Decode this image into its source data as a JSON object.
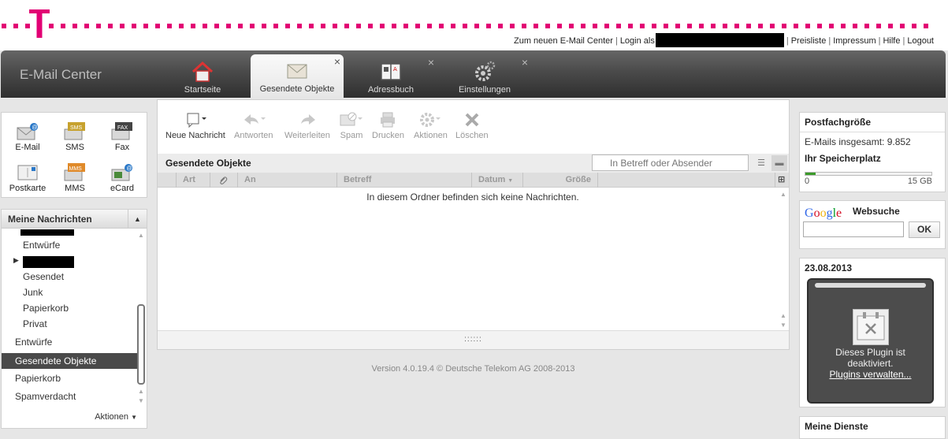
{
  "header": {
    "links": {
      "new_center": "Zum neuen E-Mail Center",
      "login_as": "Login als",
      "pricelist": "Preisliste",
      "imprint": "Impressum",
      "help": "Hilfe",
      "logout": "Logout"
    }
  },
  "nav": {
    "app_title": "E-Mail Center",
    "tabs": [
      {
        "label": "Startseite"
      },
      {
        "label": "Gesendete Objekte"
      },
      {
        "label": "Adressbuch"
      },
      {
        "label": "Einstellungen"
      }
    ],
    "close_glyph": "×"
  },
  "compose": {
    "items": [
      {
        "label": "E-Mail"
      },
      {
        "label": "SMS",
        "badge": "SMS"
      },
      {
        "label": "Fax",
        "badge": "FAX"
      },
      {
        "label": "Postkarte"
      },
      {
        "label": "MMS",
        "badge": "MMS"
      },
      {
        "label": "eCard"
      }
    ]
  },
  "folders": {
    "title": "Meine Nachrichten",
    "sub_items": [
      "Entwürfe",
      "Gesendet",
      "Junk",
      "Papierkorb",
      "Privat"
    ],
    "items": [
      "Entwürfe",
      "Gesendete Objekte",
      "Papierkorb",
      "Spamverdacht"
    ],
    "selected": "Gesendete Objekte",
    "actions": "Aktionen"
  },
  "toolbar": {
    "new_message": "Neue Nachricht",
    "answer": "Antworten",
    "forward": "Weiterleiten",
    "spam": "Spam",
    "print": "Drucken",
    "actions": "Aktionen",
    "delete": "Löschen"
  },
  "list": {
    "title": "Gesendete Objekte",
    "search_placeholder": "In Betreff oder Absender",
    "columns": [
      "Art",
      "An",
      "Betreff",
      "Datum",
      "Größe"
    ],
    "sort_column": "Datum",
    "empty_message": "In diesem Ordner befinden sich keine Nachrichten.",
    "grip": "::::::"
  },
  "footer": {
    "version": "Version 4.0.19.4 © Deutsche Telekom AG 2008-2013"
  },
  "mailbox": {
    "title": "Postfachgröße",
    "total": "E-Mails insgesamt: 9.852",
    "storage_label": "Ihr Speicherplatz",
    "min": "0",
    "max": "15 GB",
    "usage_fraction": 0.08
  },
  "websearch": {
    "title": "Websuche",
    "ok": "OK"
  },
  "date_widget": {
    "date": "23.08.2013",
    "plugin_msg_1": "Dieses Plugin ist",
    "plugin_msg_2": "deaktiviert.",
    "plugin_link": "Plugins verwalten..."
  },
  "services": {
    "title": "Meine Dienste"
  },
  "colors": {
    "brand_magenta": "#e20074",
    "storage_green": "#3b9a2a",
    "selection": "#4a4a4a"
  }
}
